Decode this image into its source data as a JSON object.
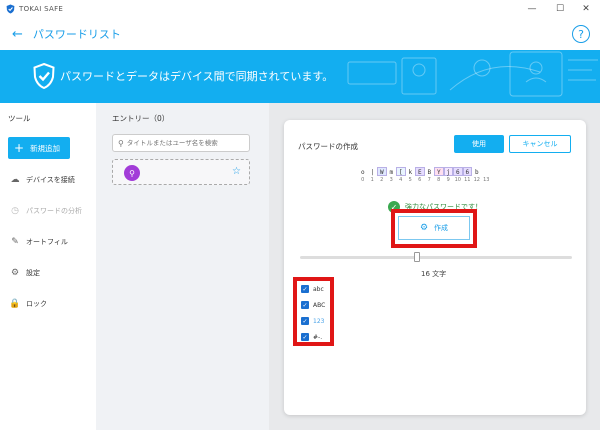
{
  "app": {
    "title": "TOKAI SAFE",
    "icon": "tokai-shield-icon"
  },
  "window_controls": {
    "minimize": "—",
    "maximize": "☐",
    "close": "✕"
  },
  "header": {
    "back_icon": "←",
    "title": "パスワードリスト",
    "help_icon": "?"
  },
  "banner": {
    "text": "パスワードとデータはデバイス間で同期されています。",
    "icon": "shield-check-icon",
    "color": "#13aef0"
  },
  "sidebar": {
    "heading": "ツール",
    "add_button": {
      "icon": "+",
      "label": "新規追加"
    },
    "items": [
      {
        "icon": "☁",
        "label": "デバイスを接続",
        "enabled": true
      },
      {
        "icon": "◷",
        "label": "パスワードの分析",
        "enabled": false
      },
      {
        "icon": "✎",
        "label": "オートフィル",
        "enabled": true
      },
      {
        "icon": "⚙",
        "label": "設定",
        "enabled": true
      },
      {
        "icon": "🔒",
        "label": "ロック",
        "enabled": true
      }
    ]
  },
  "entries": {
    "heading": "エントリー（0）",
    "search": {
      "icon": "search-icon",
      "placeholder": "タイトルまたはユーザ名を検索"
    },
    "card": {
      "icon": "key-icon",
      "star": "☆"
    }
  },
  "generator": {
    "title": "パスワードの作成",
    "use_label": "使用",
    "cancel_label": "キャンセル",
    "password_chars": [
      "o",
      "|",
      "W",
      "m",
      "[",
      "k",
      "E",
      "B",
      "Y",
      "j",
      "6",
      "6",
      "b"
    ],
    "password_indexes": [
      "0",
      "1",
      "2",
      "3",
      "4",
      "5",
      "6",
      "7",
      "8",
      "9",
      "10",
      "11",
      "12",
      "13"
    ],
    "strength_text": "強力なパスワードです！",
    "generate_label": "作成",
    "length_label": "16 文字",
    "length_value": 16,
    "slider_fraction": 0.43,
    "options": [
      {
        "label": "abc",
        "checked": true
      },
      {
        "label": "ABC",
        "checked": true
      },
      {
        "label": "123",
        "checked": true
      },
      {
        "label": "#-.",
        "checked": true
      }
    ],
    "highlight_color": "#e01616",
    "accent_color": "#13aef0"
  }
}
